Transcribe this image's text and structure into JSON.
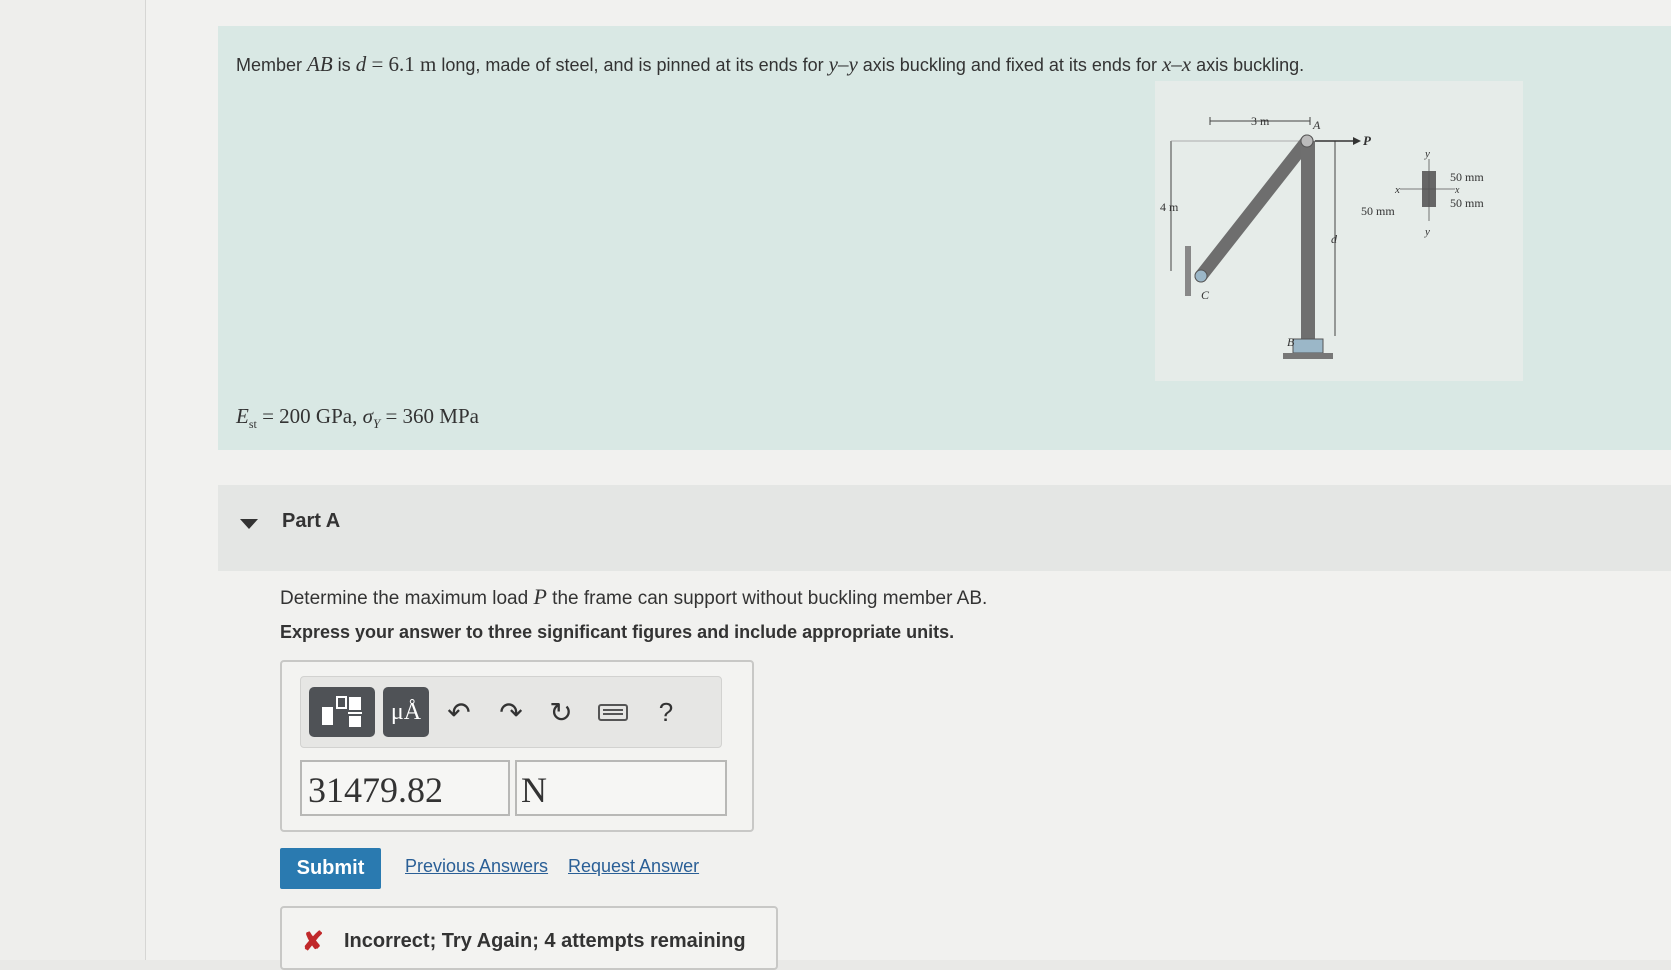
{
  "problem": {
    "statement_parts": {
      "p1": "Member ",
      "member": "AB",
      "p2": " is ",
      "d_var": "d",
      "p3": " = 6.1 ",
      "unit_m": "m",
      "p4": " long, made of steel, and is pinned at its ends for ",
      "yy": "y–y",
      "p5": " axis buckling and fixed at its ends for ",
      "xx": "x–x",
      "p6": " axis buckling."
    },
    "givens": {
      "E_sym": "E",
      "E_sub": "st",
      "E_val": " = 200 GPa, ",
      "sigma_sym": "σ",
      "sigma_sub": "Y",
      "sigma_val": " = 360 MPa"
    },
    "figure": {
      "dim_3m": "3 m",
      "dim_4m": "4 m",
      "label_A": "A",
      "label_B": "B",
      "label_C": "C",
      "label_P": "P",
      "label_d": "d",
      "sec_50_top": "50 mm",
      "sec_50_mid": "50 mm",
      "sec_50_left": "50 mm",
      "sec_x": "x",
      "sec_x2": "x",
      "sec_y": "y",
      "sec_y2": "y"
    }
  },
  "part": {
    "title": "Part A",
    "question_a": "Determine the maximum load ",
    "question_var": "P",
    "question_b": " the frame can support without buckling member AB.",
    "instruction": "Express your answer to three significant figures and include appropriate units."
  },
  "answer": {
    "value": "31479.82",
    "unit": "N",
    "toolbar": {
      "units_button": "μÅ",
      "help": "?"
    }
  },
  "actions": {
    "submit": "Submit",
    "previous_answers": "Previous Answers",
    "request_answer": "Request Answer"
  },
  "feedback": {
    "icon": "x-icon",
    "message": "Incorrect; Try Again; 4 attempts remaining"
  },
  "colors": {
    "problem_bg": "#d9e8e4",
    "submit_bg": "#2a7ab0",
    "link": "#2a5f96",
    "error": "#c0282a"
  }
}
